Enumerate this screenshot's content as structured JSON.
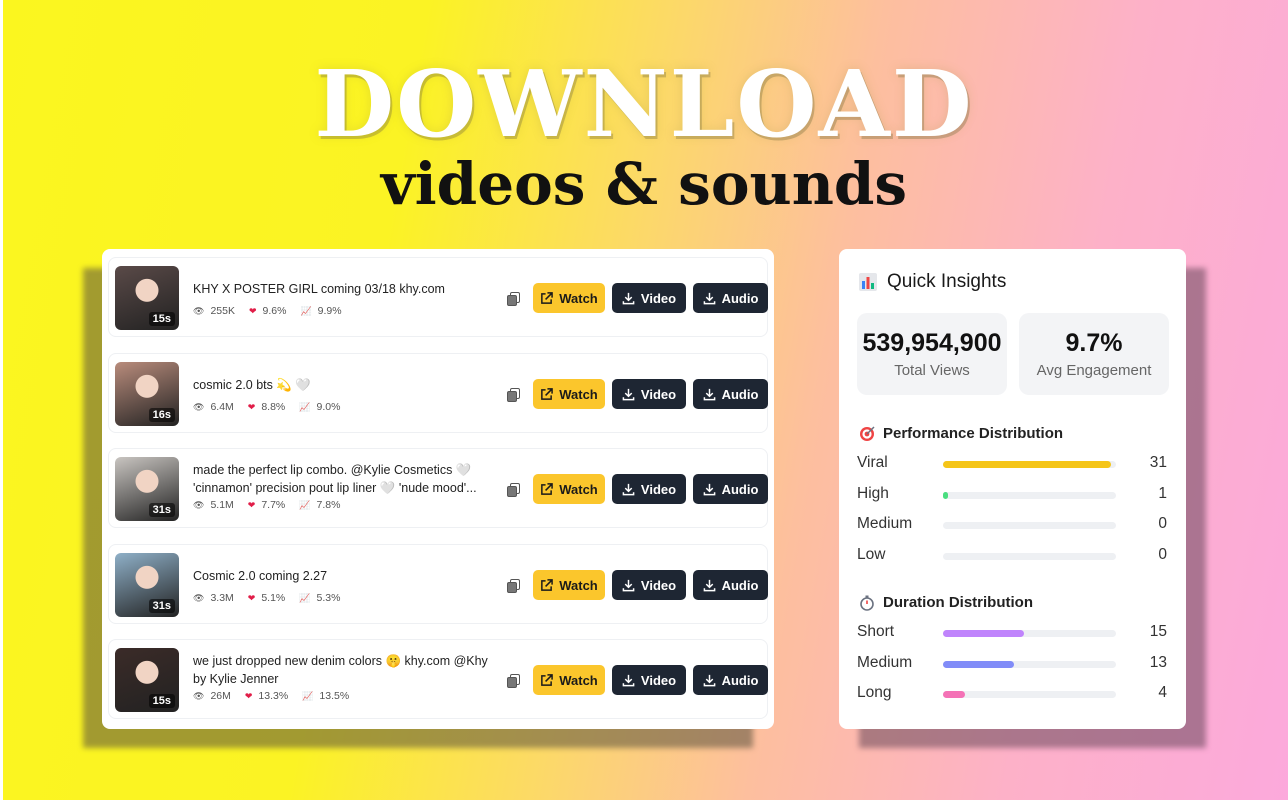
{
  "hero": {
    "headline": "DOWNLOAD",
    "subline": "videos & sounds"
  },
  "buttons": {
    "watch": "Watch",
    "video": "Video",
    "audio": "Audio"
  },
  "videos": [
    {
      "title": "KHY X POSTER GIRL coming 03/18 khy.com",
      "duration": "15s",
      "views": "255K",
      "likes": "9.6%",
      "engagement": "9.9%",
      "thumb_color": "#5a4a48"
    },
    {
      "title": "cosmic 2.0 bts 💫 🤍",
      "duration": "16s",
      "views": "6.4M",
      "likes": "8.8%",
      "engagement": "9.0%",
      "thumb_color": "#b98c7c"
    },
    {
      "title": "made the perfect lip combo. @Kylie Cosmetics 🤍 'cinnamon' precision pout lip liner 🤍 'nude mood'...",
      "duration": "31s",
      "views": "5.1M",
      "likes": "7.7%",
      "engagement": "7.8%",
      "thumb_color": "#c9c5c1"
    },
    {
      "title": "Cosmic 2.0 coming 2.27",
      "duration": "31s",
      "views": "3.3M",
      "likes": "5.1%",
      "engagement": "5.3%",
      "thumb_color": "#8fb0c8"
    },
    {
      "title": "we just dropped new denim colors 🤫 khy.com @Khy by Kylie Jenner",
      "duration": "15s",
      "views": "26M",
      "likes": "13.3%",
      "engagement": "13.5%",
      "thumb_color": "#3b2b28"
    }
  ],
  "insights": {
    "title": "Quick Insights",
    "total_views": "539,954,900",
    "total_views_label": "Total Views",
    "avg_engagement": "9.7%",
    "avg_engagement_label": "Avg Engagement",
    "performance_title": "Performance Distribution",
    "performance": [
      {
        "label": "Viral",
        "count": "31",
        "fraction": 0.97,
        "color": "#f5c518"
      },
      {
        "label": "High",
        "count": "1",
        "fraction": 0.03,
        "color": "#4ade80"
      },
      {
        "label": "Medium",
        "count": "0",
        "fraction": 0,
        "color": "#cccccc"
      },
      {
        "label": "Low",
        "count": "0",
        "fraction": 0,
        "color": "#cccccc"
      }
    ],
    "duration_title": "Duration Distribution",
    "duration": [
      {
        "label": "Short",
        "count": "15",
        "fraction": 0.47,
        "color": "#c084fc"
      },
      {
        "label": "Medium",
        "count": "13",
        "fraction": 0.41,
        "color": "#818cf8"
      },
      {
        "label": "Long",
        "count": "4",
        "fraction": 0.13,
        "color": "#f472b6"
      }
    ]
  }
}
